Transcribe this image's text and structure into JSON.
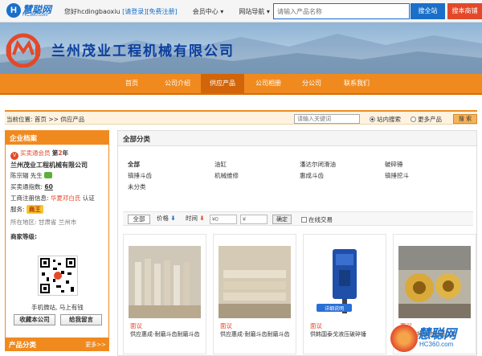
{
  "site": {
    "logo_text": "慧聪网",
    "logo_url": "HC360.com",
    "greeting": "您好hcdingbaoxiu",
    "login": "[请登录]",
    "register": "[免费注册]",
    "member_center": "会员中心",
    "site_nav": "网站导航",
    "search_placeholder": "请输入产品名称",
    "search_all": "搜全站",
    "search_store": "搜本商铺"
  },
  "banner": {
    "company_name": "兰州茂业工程机械有限公司"
  },
  "nav": {
    "items": [
      "首页",
      "公司介绍",
      "供应产品",
      "公司相册",
      "分公司",
      "联系我们"
    ],
    "active_index": 2
  },
  "crumb": {
    "label": "当前位置:",
    "home": "首页",
    "sep": ">>",
    "current": "供应产品",
    "keyword_placeholder": "请输入关键词",
    "radio_site": "站内搜索",
    "radio_more": "更多产品",
    "search_btn": "搜 索"
  },
  "sidebar": {
    "title": "企业档案",
    "member_type": "买卖通会员",
    "years_prefix": "第",
    "years": "2",
    "years_suffix": "年",
    "company": "兰州茂业工程机械有限公司",
    "contact": "陈宗辐 先生",
    "index_label": "买卖通指数:",
    "index_value": "60",
    "reg_label": "工商注册信息:",
    "reg_value": "华夏邓白氏",
    "reg_status": "认证",
    "service_label": "服务:",
    "service_badge": "商王",
    "location": "所在地区: 甘肃省 兰州市",
    "rating_label": "商家等级:",
    "mobile_text": "手机微站, 马上有钱",
    "btn_bookmark": "收藏本公司",
    "btn_message": "给我留言",
    "cat_title": "产品分类",
    "cat_more": "更多>>"
  },
  "main": {
    "title": "全部分类",
    "categories": [
      {
        "label": "全部",
        "bold": true
      },
      {
        "label": "油缸",
        "bold": false
      },
      {
        "label": "潘达尔闭滑油",
        "bold": false
      },
      {
        "label": "破碎锤",
        "bold": false
      },
      {
        "label": "镐捶斗齿",
        "bold": false
      },
      {
        "label": "机械维修",
        "bold": false
      },
      {
        "label": "惠成斗齿",
        "bold": false
      },
      {
        "label": "镐捶挖斗",
        "bold": false
      },
      {
        "label": "未分类",
        "bold": false
      }
    ],
    "filter": {
      "all": "全部",
      "price": "价格",
      "price_arrow": "⬇",
      "time": "时间",
      "time_arrow": "⬇",
      "min_placeholder": "¥0",
      "max_placeholder": "¥",
      "confirm": "确定",
      "online": "在线交易"
    },
    "products": [
      {
        "tag": "面议",
        "name": "供应惠成-耐磨斗齿耐磨斗齿"
      },
      {
        "tag": "面议",
        "name": "供应惠成-耐磨斗齿耐磨斗齿"
      },
      {
        "tag": "面议",
        "name": "供韩国泰戈液压破碎锤"
      },
      {
        "tag": "面议",
        "name": "供应镐捶斗齿耐磨斗齿"
      }
    ],
    "product_image_label": "详细说明"
  },
  "watermark": {
    "text": "慧聪网",
    "url": "HC360.com"
  },
  "colors": {
    "orange": "#f08a1e",
    "blue": "#1a6fc9",
    "red": "#e2492a"
  }
}
